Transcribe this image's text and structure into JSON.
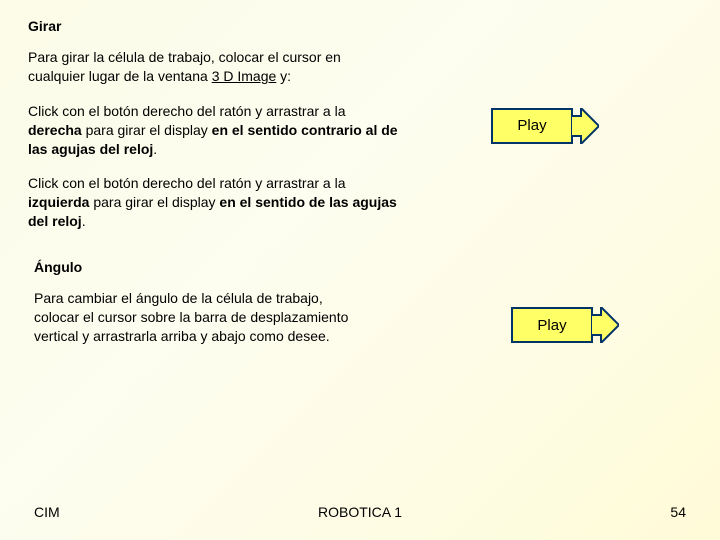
{
  "section1": {
    "heading": "Girar",
    "p1_a": "Para girar la célula de trabajo, colocar el cursor en cualquier lugar de la ventana ",
    "p1_b": "3 D Image",
    "p1_c": " y:",
    "p2_a": "Click con el botón derecho del ratón y arrastrar a la ",
    "p2_b": "derecha",
    "p2_c": " para girar el display ",
    "p2_d": "en el sentido contrario al de las agujas del reloj",
    "p2_e": ".",
    "p3_a": "Click con el botón derecho del ratón y arrastrar a la ",
    "p3_b": "izquierda",
    "p3_c": " para girar el display ",
    "p3_d": "en el sentido de las agujas del reloj",
    "p3_e": "."
  },
  "section2": {
    "heading": "Ángulo",
    "p1": "Para cambiar el ángulo de la célula de trabajo, colocar el cursor sobre la barra de desplazamiento vertical y arrastrarla arriba y abajo como desee."
  },
  "buttons": {
    "play1": "Play",
    "play2": "Play"
  },
  "footer": {
    "left": "CIM",
    "center": "ROBOTICA 1",
    "right": "54"
  }
}
